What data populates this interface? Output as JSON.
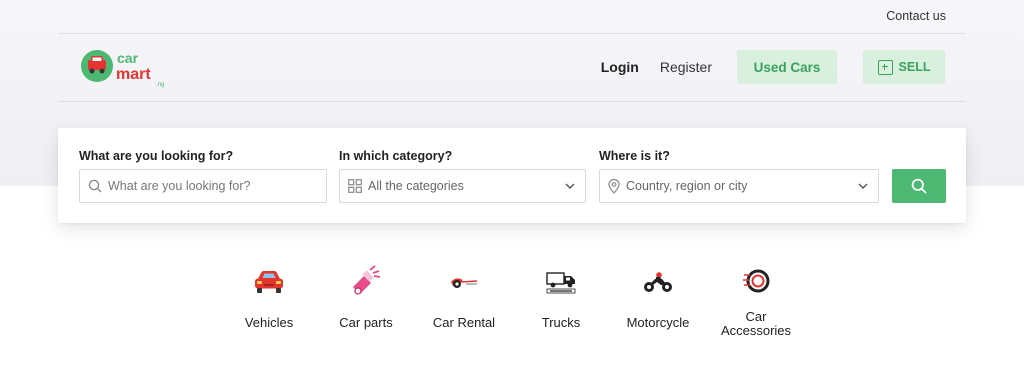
{
  "header": {
    "contact": "Contact us",
    "logo": {
      "line1": "car",
      "line2": "mart",
      "suffix": ".ng"
    },
    "nav": {
      "login": "Login",
      "register": "Register",
      "used_cars": "Used Cars",
      "sell": "SELL"
    }
  },
  "search": {
    "what": {
      "label": "What are you looking for?",
      "placeholder": "What are you looking for?"
    },
    "category": {
      "label": "In which category?",
      "value": "All the categories"
    },
    "where": {
      "label": "Where is it?",
      "value": "Country, region or city"
    }
  },
  "categories": [
    {
      "label": "Vehicles",
      "icon": "car-icon"
    },
    {
      "label": "Car parts",
      "icon": "car-parts-icon"
    },
    {
      "label": "Car Rental",
      "icon": "car-rental-icon"
    },
    {
      "label": "Trucks",
      "icon": "truck-icon"
    },
    {
      "label": "Motorcycle",
      "icon": "motorcycle-icon"
    },
    {
      "label": "Car Accessories",
      "icon": "tire-icon"
    }
  ],
  "colors": {
    "brand_green": "#4cb872",
    "brand_red": "#e3342f",
    "soft_green": "#d9f0df"
  }
}
